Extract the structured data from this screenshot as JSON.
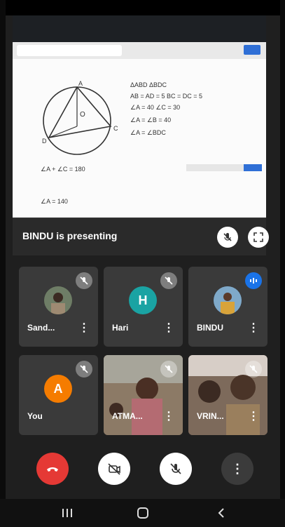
{
  "presentation": {
    "presenter_text": "BINDU is presenting"
  },
  "participants": [
    {
      "name": "Sand...",
      "type": "photo",
      "muted": true
    },
    {
      "name": "Hari",
      "type": "letter",
      "letter": "H",
      "color": "#1aa3a3",
      "muted": true
    },
    {
      "name": "BINDU",
      "type": "photo",
      "speaking": true
    },
    {
      "name": "You",
      "type": "letter",
      "letter": "A",
      "color": "#f57c00",
      "muted": true
    },
    {
      "name": "ATMA...",
      "type": "video",
      "muted": true
    },
    {
      "name": "VRIN...",
      "type": "video",
      "muted": true
    }
  ],
  "controls": {
    "end_call_color": "#e53935",
    "control_bg": "#ffffff"
  },
  "whiteboard": {
    "lines": [
      "ΔABD   ΔBDC",
      "AB = AD = 5   BC = DC = 5",
      "∠A = 40   ∠C = 30",
      "∠A = ∠B = 40",
      "∠A = ∠BDC",
      "∠A + ∠C = 180",
      "∠A = 140"
    ]
  }
}
